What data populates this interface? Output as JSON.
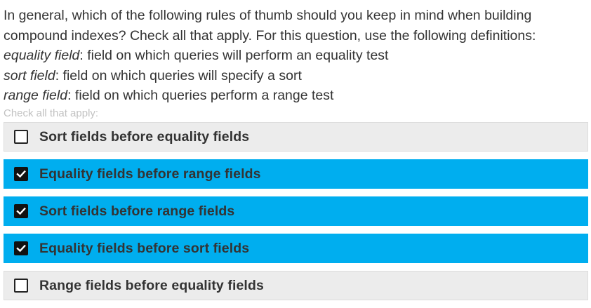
{
  "question": {
    "line1": "In general, which of the following rules of thumb should you keep in mind when building",
    "line2": "compound indexes? Check all that apply. For this question, use the following definitions:",
    "definitions": [
      {
        "term": "equality field",
        "desc": ": field on which queries will perform an equality test"
      },
      {
        "term": "sort field",
        "desc": ": field on which queries will specify a sort"
      },
      {
        "term": "range field",
        "desc": ": field on which queries perform a range test"
      }
    ]
  },
  "hint": "Check all that apply:",
  "options": [
    {
      "label": "Sort fields before equality fields",
      "checked": false
    },
    {
      "label": "Equality fields before range fields",
      "checked": true
    },
    {
      "label": "Sort fields before range fields",
      "checked": true
    },
    {
      "label": "Equality fields before sort fields",
      "checked": true
    },
    {
      "label": "Range fields before equality fields",
      "checked": false
    }
  ],
  "colors": {
    "selected_bg": "#00aeef",
    "unselected_bg": "#ececec",
    "text": "#333333",
    "hint": "#c2c2c2"
  },
  "icons": {
    "checked": "checkbox-checked-icon",
    "unchecked": "checkbox-unchecked-icon"
  }
}
